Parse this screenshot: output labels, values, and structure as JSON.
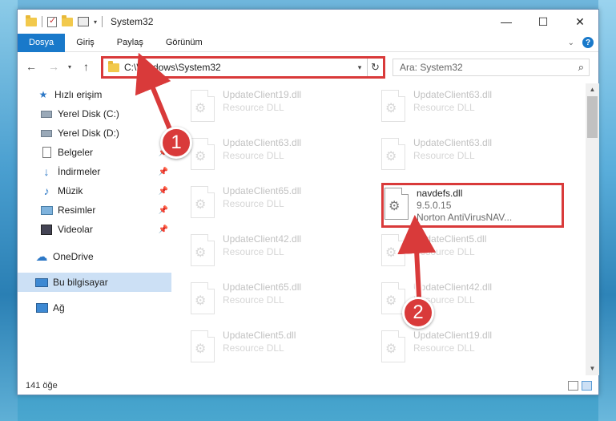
{
  "window": {
    "title": "System32",
    "controls": {
      "minimize": "—",
      "maximize": "☐",
      "close": "✕"
    }
  },
  "ribbon": {
    "tabs": [
      {
        "label": "Dosya",
        "active": true
      },
      {
        "label": "Giriş"
      },
      {
        "label": "Paylaş"
      },
      {
        "label": "Görünüm"
      }
    ],
    "help": "?"
  },
  "nav": {
    "address": "C:\\Windows\\System32",
    "search_placeholder": "Ara: System32"
  },
  "sidebar": {
    "items": [
      {
        "label": "Hızlı erişim",
        "icon": "star-icon"
      },
      {
        "label": "Yerel Disk (C:)",
        "icon": "drive-icon"
      },
      {
        "label": "Yerel Disk (D:)",
        "icon": "drive-icon"
      },
      {
        "label": "Belgeler",
        "icon": "documents-icon",
        "pinned": true
      },
      {
        "label": "İndirmeler",
        "icon": "download-icon",
        "pinned": true
      },
      {
        "label": "Müzik",
        "icon": "music-icon",
        "pinned": true
      },
      {
        "label": "Resimler",
        "icon": "pictures-icon",
        "pinned": true
      },
      {
        "label": "Videolar",
        "icon": "videos-icon",
        "pinned": true
      },
      {
        "label": "OneDrive",
        "icon": "cloud-icon"
      },
      {
        "label": "Bu bilgisayar",
        "icon": "computer-icon",
        "selected": true
      },
      {
        "label": "Ağ",
        "icon": "network-icon"
      }
    ]
  },
  "files": [
    {
      "name": "UpdateClient19.dll",
      "sub": "Resource DLL"
    },
    {
      "name": "UpdateClient63.dll",
      "sub": "Resource DLL"
    },
    {
      "name": "UpdateClient63.dll",
      "sub": "Resource DLL"
    },
    {
      "name": "UpdateClient63.dll",
      "sub": "Resource DLL"
    },
    {
      "name": "UpdateClient65.dll",
      "sub": "Resource DLL"
    },
    {
      "name": "navdefs.dll",
      "version": "9.5.0.15",
      "sub": "Norton AntiVirusNAV...",
      "highlighted": true
    },
    {
      "name": "UpdateClient42.dll",
      "sub": "Resource DLL"
    },
    {
      "name": "UpdateClient5.dll",
      "sub": "Resource DLL"
    },
    {
      "name": "UpdateClient65.dll",
      "sub": "Resource DLL"
    },
    {
      "name": "UpdateClient42.dll",
      "sub": "Resource DLL"
    },
    {
      "name": "UpdateClient5.dll",
      "sub": "Resource DLL"
    },
    {
      "name": "UpdateClient19.dll",
      "sub": "Resource DLL"
    }
  ],
  "status": {
    "count": "141 öğe"
  },
  "annotations": {
    "step1": "1",
    "step2": "2",
    "color": "#d93a3a"
  }
}
